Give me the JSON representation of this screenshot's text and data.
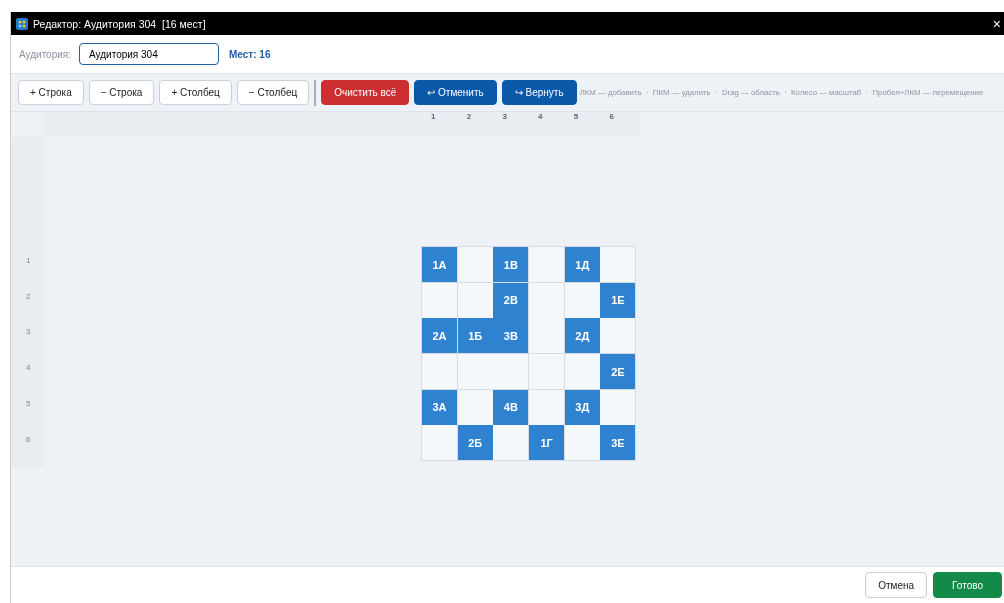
{
  "window": {
    "title": "Редактор: Аудитория 304  [16 мест]",
    "close": "×"
  },
  "header": {
    "label": "Аудитория:",
    "value": "Аудитория 304",
    "count": "Мест: 16"
  },
  "toolbar": [
    {
      "kind": "plain",
      "label": "+ Строка"
    },
    {
      "kind": "plain",
      "label": "− Строка"
    },
    {
      "kind": "plain",
      "label": "+ Столбец"
    },
    {
      "kind": "plain",
      "label": "− Столбец"
    },
    {
      "kind": "divider"
    },
    {
      "kind": "danger",
      "label": "Очистить всё"
    },
    {
      "kind": "primary",
      "label": "↩ Отменить"
    },
    {
      "kind": "primary",
      "label": "↪ Вернуть"
    }
  ],
  "hint": "ЛКМ — добавить  ·  ПКМ — удалить  ·  Drag — область  ·  Колесо — масштаб  ·  Пробел+ЛКМ — перемещение",
  "grid": {
    "columns": [
      "1",
      "2",
      "3",
      "4",
      "5",
      "6"
    ],
    "rows": [
      {
        "label": "1",
        "cells": [
          {
            "seat": true,
            "label": "1А"
          },
          {
            "seat": false
          },
          {
            "seat": true,
            "label": "1В"
          },
          {
            "seat": false
          },
          {
            "seat": true,
            "label": "1Д"
          },
          {
            "seat": false
          }
        ]
      },
      {
        "label": "2",
        "cells": [
          {
            "seat": false
          },
          {
            "seat": false
          },
          {
            "seat": true,
            "label": "2В"
          },
          {
            "seat": false
          },
          {
            "seat": false
          },
          {
            "seat": true,
            "label": "1Е"
          }
        ]
      },
      {
        "label": "3",
        "cells": [
          {
            "seat": true,
            "label": "2А"
          },
          {
            "seat": true,
            "label": "1Б"
          },
          {
            "seat": true,
            "label": "3В"
          },
          {
            "seat": false
          },
          {
            "seat": true,
            "label": "2Д"
          },
          {
            "seat": false
          }
        ]
      },
      {
        "label": "4",
        "cells": [
          {
            "seat": false
          },
          {
            "seat": false
          },
          {
            "seat": false
          },
          {
            "seat": false
          },
          {
            "seat": false
          },
          {
            "seat": true,
            "label": "2Е"
          }
        ]
      },
      {
        "label": "5",
        "cells": [
          {
            "seat": true,
            "label": "3А"
          },
          {
            "seat": false
          },
          {
            "seat": true,
            "label": "4В"
          },
          {
            "seat": false
          },
          {
            "seat": true,
            "label": "3Д"
          },
          {
            "seat": false
          }
        ]
      },
      {
        "label": "6",
        "cells": [
          {
            "seat": false
          },
          {
            "seat": true,
            "label": "2Б"
          },
          {
            "seat": false
          },
          {
            "seat": true,
            "label": "1Г"
          },
          {
            "seat": false
          },
          {
            "seat": true,
            "label": "3Е"
          }
        ]
      }
    ]
  },
  "footer": {
    "buttons": [
      {
        "kind": "plain",
        "label": "Отмена"
      },
      {
        "kind": "ok",
        "label": "Готово"
      }
    ]
  }
}
